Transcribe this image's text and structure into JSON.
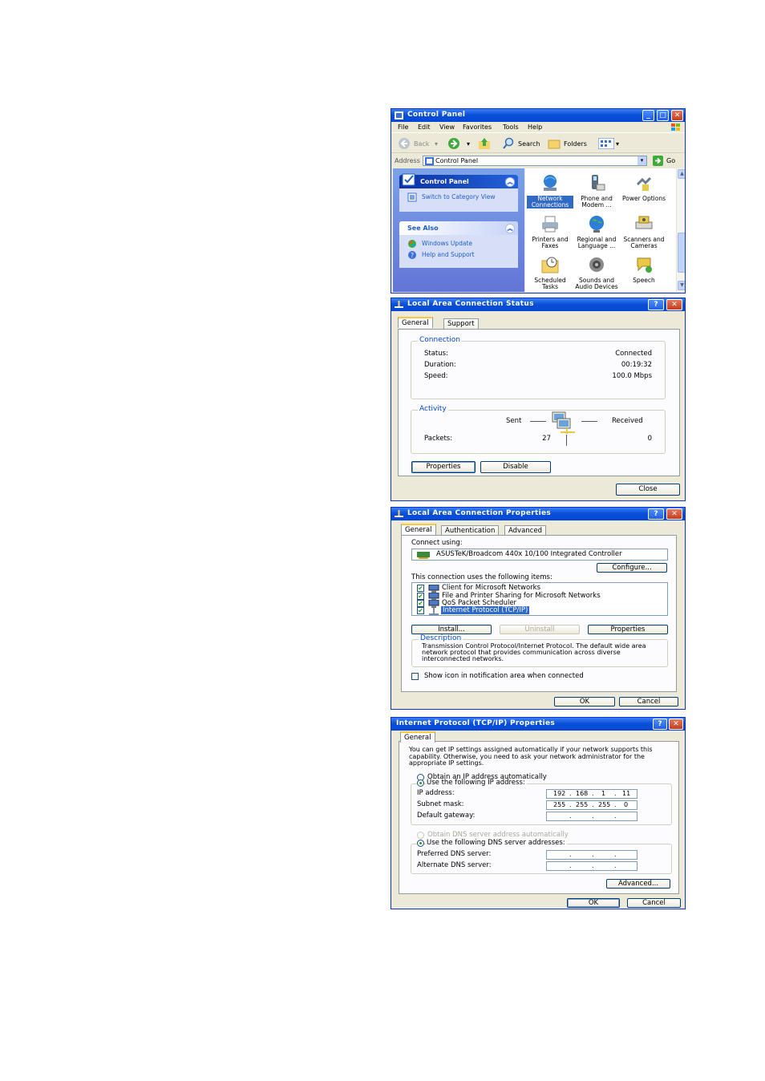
{
  "control_panel": {
    "title": "Control Panel",
    "menu": [
      "File",
      "Edit",
      "View",
      "Favorites",
      "Tools",
      "Help"
    ],
    "toolbar": {
      "back": "Back",
      "search": "Search",
      "folders": "Folders"
    },
    "address": {
      "label": "Address",
      "value": "Control Panel",
      "go": "Go"
    },
    "panel_title": "Control Panel",
    "switch_view": "Switch to Category View",
    "see_also_title": "See Also",
    "see_also": [
      "Windows Update",
      "Help and Support"
    ],
    "items": [
      {
        "label": "Network Connections",
        "icon": "network-connections-icon",
        "selected": true
      },
      {
        "label": "Phone and Modem ...",
        "icon": "phone-modem-icon"
      },
      {
        "label": "Power Options",
        "icon": "power-options-icon"
      },
      {
        "label": "Printers and Faxes",
        "icon": "printers-icon"
      },
      {
        "label": "Regional and Language ...",
        "icon": "globe-icon"
      },
      {
        "label": "Scanners and Cameras",
        "icon": "scanner-icon"
      },
      {
        "label": "Scheduled Tasks",
        "icon": "scheduled-tasks-icon"
      },
      {
        "label": "Sounds and Audio Devices",
        "icon": "speaker-icon"
      },
      {
        "label": "Speech",
        "icon": "speech-icon"
      }
    ]
  },
  "status_dialog": {
    "title": "Local Area Connection Status",
    "tabs": [
      "General",
      "Support"
    ],
    "connection_group": "Connection",
    "status_label": "Status:",
    "status_value": "Connected",
    "duration_label": "Duration:",
    "duration_value": "00:19:32",
    "speed_label": "Speed:",
    "speed_value": "100.0 Mbps",
    "activity_group": "Activity",
    "sent": "Sent",
    "received": "Received",
    "packets_label": "Packets:",
    "packets_sent": "27",
    "packets_received": "0",
    "properties_btn": "Properties",
    "disable_btn": "Disable",
    "close_btn": "Close"
  },
  "properties_dialog": {
    "title": "Local Area Connection Properties",
    "tabs": [
      "General",
      "Authentication",
      "Advanced"
    ],
    "connect_using": "Connect using:",
    "adapter": "ASUSTeK/Broadcom 440x 10/100 Integrated Controller",
    "configure_btn": "Configure...",
    "items_label": "This connection uses the following items:",
    "items": [
      {
        "label": "Client for Microsoft Networks",
        "checked": true
      },
      {
        "label": "File and Printer Sharing for Microsoft Networks",
        "checked": true
      },
      {
        "label": "QoS Packet Scheduler",
        "checked": true
      },
      {
        "label": "Internet Protocol (TCP/IP)",
        "checked": true,
        "selected": true
      }
    ],
    "install_btn": "Install...",
    "uninstall_btn": "Uninstall",
    "properties_btn": "Properties",
    "description_group": "Description",
    "description": "Transmission Control Protocol/Internet Protocol. The default wide area network protocol that provides communication across diverse interconnected networks.",
    "show_icon": "Show icon in notification area when connected",
    "ok_btn": "OK",
    "cancel_btn": "Cancel"
  },
  "tcpip_dialog": {
    "title": "Internet Protocol (TCP/IP) Properties",
    "tab": "General",
    "intro": "You can get IP settings assigned automatically if your network supports this capability. Otherwise, you need to ask your network administrator for the appropriate IP settings.",
    "obtain_ip": "Obtain an IP address automatically",
    "use_ip": "Use the following IP address:",
    "ip_label": "IP address:",
    "ip": [
      "192",
      "168",
      "1",
      "11"
    ],
    "mask_label": "Subnet mask:",
    "mask": [
      "255",
      "255",
      "255",
      "0"
    ],
    "gateway_label": "Default gateway:",
    "obtain_dns": "Obtain DNS server address automatically",
    "use_dns": "Use the following DNS server addresses:",
    "pref_dns_label": "Preferred DNS server:",
    "alt_dns_label": "Alternate DNS server:",
    "advanced_btn": "Advanced...",
    "ok_btn": "OK",
    "cancel_btn": "Cancel"
  }
}
